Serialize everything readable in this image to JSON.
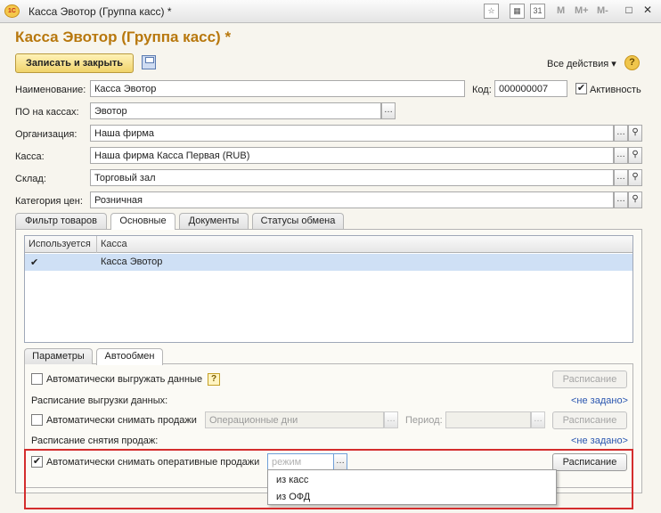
{
  "window": {
    "title": "Касса Эвотор (Группа касс) *",
    "toolbar_texts": [
      "M",
      "M+",
      "M-"
    ]
  },
  "form": {
    "title": "Касса Эвотор (Группа касс) *",
    "save_close_label": "Записать и закрыть",
    "all_actions_label": "Все действия ▾",
    "help_label": "?"
  },
  "fields": {
    "name_label": "Наименование:",
    "name_value": "Касса Эвотор",
    "code_label": "Код:",
    "code_value": "000000007",
    "active_label": "Активность",
    "active_checked": true,
    "po_label": "ПО на кассах:",
    "po_value": "Эвотор",
    "org_label": "Организация:",
    "org_value": "Наша фирма",
    "kassa_label": "Касса:",
    "kassa_value": "Наша фирма Касса Первая (RUB)",
    "sklad_label": "Склад:",
    "sklad_value": "Торговый зал",
    "price_label": "Категория цен:",
    "price_value": "Розничная"
  },
  "tabs": [
    {
      "label": "Фильтр товаров",
      "active": false
    },
    {
      "label": "Основные",
      "active": true
    },
    {
      "label": "Документы",
      "active": false
    },
    {
      "label": "Статусы обмена",
      "active": false
    }
  ],
  "table": {
    "columns": [
      "Используется",
      "Касса"
    ],
    "rows": [
      {
        "used": "✔",
        "kassa": "Касса Эвотор"
      }
    ]
  },
  "subtabs": [
    {
      "label": "Параметры",
      "active": false
    },
    {
      "label": "Автообмен",
      "active": true
    }
  ],
  "autoexchange": {
    "upload_label": "Автоматически выгружать данные",
    "upload_checked": false,
    "upload_help": "?",
    "schedule_button": "Расписание",
    "upload_schedule_label": "Расписание выгрузки данных:",
    "not_set_link": "<не задано>",
    "sales_label": "Автоматически снимать продажи",
    "sales_checked": false,
    "sales_mode_placeholder": "Операционные дни",
    "period_label": "Период:",
    "sales_schedule_label": "Расписание снятия продаж:",
    "oper_sales_label": "Автоматически снимать оперативные продажи",
    "oper_sales_checked": true,
    "mode_placeholder": "режим"
  },
  "dropdown": {
    "options": [
      "из касс",
      "из ОФД"
    ]
  }
}
